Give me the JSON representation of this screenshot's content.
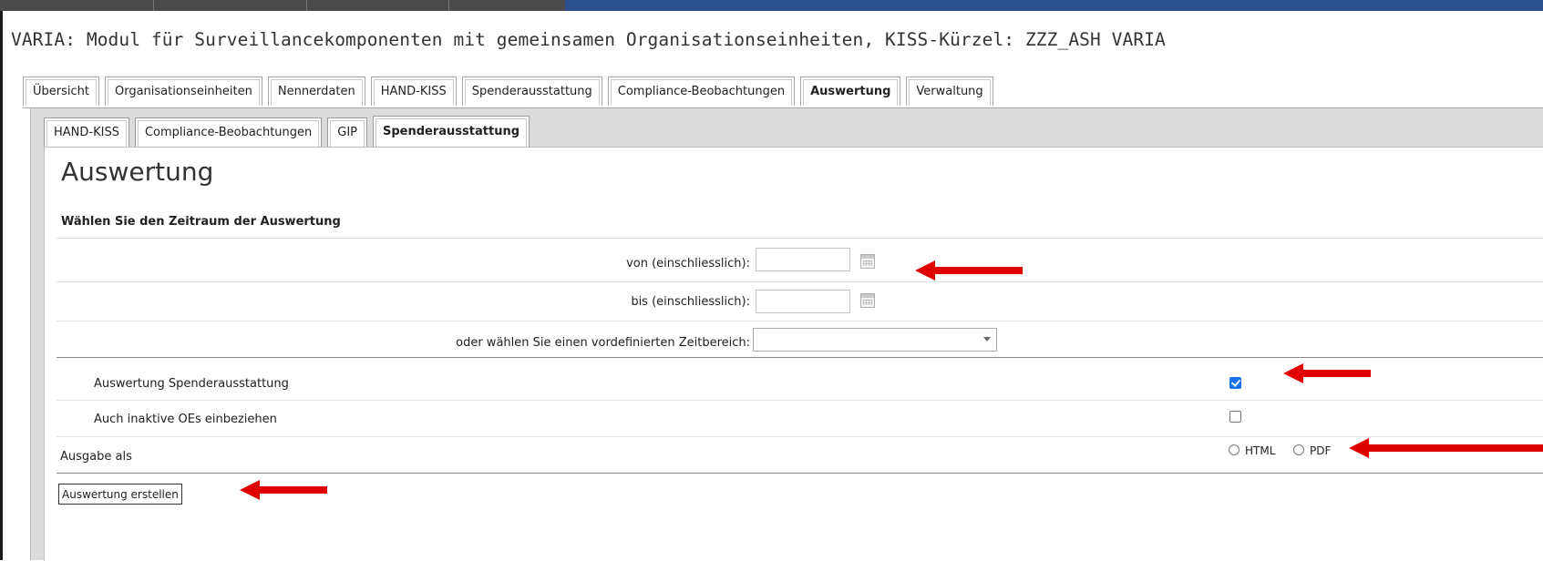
{
  "page": {
    "title": "VARIA: Modul für Surveillancekomponenten mit gemeinsamen Organisationseinheiten, KISS-Kürzel: ZZZ_ASH VARIA"
  },
  "main_tabs": [
    {
      "label": "Übersicht"
    },
    {
      "label": "Organisationseinheiten"
    },
    {
      "label": "Nennerdaten"
    },
    {
      "label": "HAND-KISS"
    },
    {
      "label": "Spenderausstattung"
    },
    {
      "label": "Compliance-Beobachtungen"
    },
    {
      "label": "Auswertung",
      "active": true
    },
    {
      "label": "Verwaltung"
    }
  ],
  "sub_tabs": [
    {
      "label": "HAND-KISS"
    },
    {
      "label": "Compliance-Beobachtungen"
    },
    {
      "label": "GIP"
    },
    {
      "label": "Spenderausstattung",
      "active": true
    }
  ],
  "content": {
    "heading": "Auswertung",
    "section_title": "Wählen Sie den Zeitraum der Auswertung",
    "from_label": "von (einschliesslich):",
    "from_value": "",
    "to_label": "bis (einschliesslich):",
    "to_value": "",
    "predefined_label": "oder wählen Sie einen vordefinierten Zeitbereich:",
    "predefined_value": "",
    "option_spender_label": "Auswertung Spenderausstattung",
    "option_spender_checked": true,
    "option_inactive_label": "Auch inaktive OEs einbeziehen",
    "option_inactive_checked": false,
    "output_label": "Ausgabe als",
    "output_options": [
      "HTML",
      "PDF"
    ],
    "submit_label": "Auswertung erstellen"
  },
  "colors": {
    "annotation_arrow": "#e00000",
    "checkbox_checked": "#1a73e8"
  }
}
